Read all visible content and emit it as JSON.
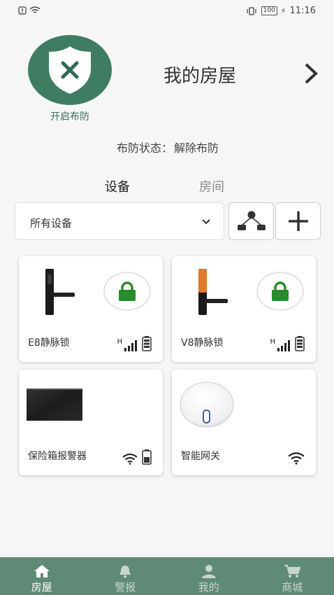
{
  "status_bar": {
    "time": "11:16",
    "battery": "100"
  },
  "arm_button": {
    "label": "开启布防"
  },
  "home": {
    "title": "我的房屋"
  },
  "arm_status": {
    "label": "布防状态：",
    "value": "解除布防"
  },
  "tabs": [
    {
      "label": "设备",
      "active": true
    },
    {
      "label": "房间",
      "active": false
    }
  ],
  "filter": {
    "selected": "所有设备"
  },
  "devices": [
    {
      "name": "E8静脉锁",
      "signal_letter": "H"
    },
    {
      "name": "V8静脉锁",
      "signal_letter": "H"
    },
    {
      "name": "保险箱报警器"
    },
    {
      "name": "智能网关"
    }
  ],
  "bottom_nav": [
    {
      "label": "房屋",
      "active": true
    },
    {
      "label": "警报",
      "active": false
    },
    {
      "label": "我的",
      "active": false
    },
    {
      "label": "商城",
      "active": false
    }
  ],
  "colors": {
    "primary": "#3f7d63",
    "nav_bg": "#5f8a75",
    "lock_green": "#2b8a2b"
  }
}
